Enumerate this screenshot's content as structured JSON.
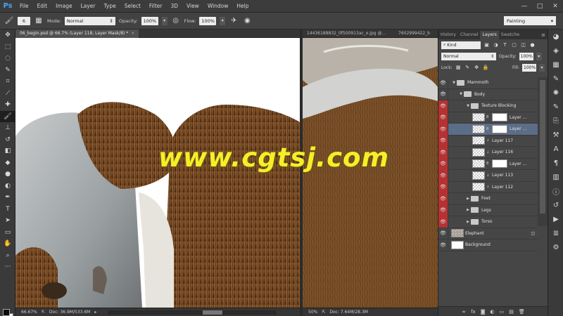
{
  "app": {
    "logo": "Ps",
    "menu": [
      "File",
      "Edit",
      "Image",
      "Layer",
      "Type",
      "Select",
      "Filter",
      "3D",
      "View",
      "Window",
      "Help"
    ],
    "window_controls": [
      "—",
      "□",
      "✕"
    ]
  },
  "options": {
    "brush_size": "6",
    "mode_label": "Mode:",
    "mode_value": "Normal",
    "opacity_label": "Opacity:",
    "opacity_value": "100%",
    "flow_label": "Flow:",
    "flow_value": "100%",
    "workspace": "Painting"
  },
  "documents": [
    {
      "tab": "06_begin.psd @ 66.7% (Layer 118, Layer Mask/8) *",
      "zoom": "66.67%",
      "doc_info": "Doc: 36.9M/533.6M"
    },
    {
      "tab_1": "14436188832_0f500913ac_o.jpg @...",
      "tab_2": "7602999422_b",
      "zoom": "50%",
      "doc_info": "Doc: 7.64M/28.3M"
    }
  ],
  "layers_panel": {
    "tabs": [
      "History",
      "Channel",
      "Layers",
      "Swatche"
    ],
    "active_tab": "Layers",
    "kind_label": "Kind",
    "blend_mode": "Normal",
    "opacity_label": "Opacity:",
    "opacity_value": "100%",
    "lock_label": "Lock:",
    "fill_label": "Fill:",
    "fill_value": "100%",
    "layers": [
      {
        "name": "Mammoth",
        "kind": "group",
        "indent": 0,
        "red": false,
        "expanded": true
      },
      {
        "name": "Body",
        "kind": "group",
        "indent": 1,
        "red": false,
        "expanded": true
      },
      {
        "name": "Texture Blocking",
        "kind": "group",
        "indent": 2,
        "red": true,
        "expanded": true
      },
      {
        "name": "Layer ...",
        "kind": "masked",
        "indent": 3,
        "red": true
      },
      {
        "name": "Layer ...",
        "kind": "masked",
        "indent": 3,
        "red": true,
        "selected": true
      },
      {
        "name": "Layer 117",
        "kind": "layer",
        "indent": 3,
        "red": true
      },
      {
        "name": "Layer 116",
        "kind": "layer",
        "indent": 3,
        "red": true
      },
      {
        "name": "Layer ...",
        "kind": "masked",
        "indent": 3,
        "red": true
      },
      {
        "name": "Layer 113",
        "kind": "layer",
        "indent": 3,
        "red": true
      },
      {
        "name": "Layer 112",
        "kind": "layer",
        "indent": 3,
        "red": true
      },
      {
        "name": "Feet",
        "kind": "group",
        "indent": 2,
        "red": true,
        "expanded": false
      },
      {
        "name": "Legs",
        "kind": "group",
        "indent": 2,
        "red": true,
        "expanded": false
      },
      {
        "name": "Torso",
        "kind": "group",
        "indent": 2,
        "red": true,
        "expanded": false
      },
      {
        "name": "Elephant",
        "kind": "photo",
        "indent": 0,
        "red": false,
        "fx": true
      },
      {
        "name": "Background",
        "kind": "white",
        "indent": 0,
        "red": false
      }
    ]
  },
  "watermark": "www.cgtsj.com"
}
